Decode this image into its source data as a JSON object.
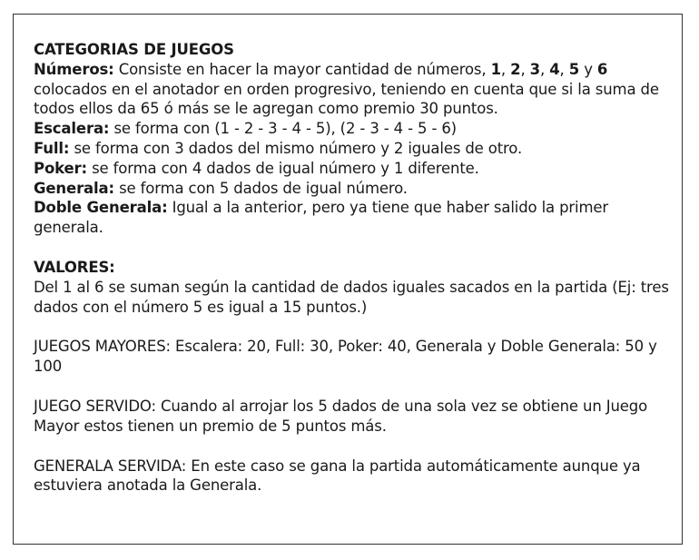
{
  "categorias": {
    "heading": "CATEGORIAS DE JUEGOS",
    "numeros": {
      "label": "Números:",
      "text1": " Consiste en hacer la mayor cantidad de números, ",
      "n1": "1",
      "sep1": ", ",
      "n2": "2",
      "sep2": ", ",
      "n3": "3",
      "sep3": ", ",
      "n4": "4",
      "sep4": ", ",
      "n5": "5",
      "sep5": " y ",
      "n6": "6",
      "text2": " colocados en el anotador en orden progresivo, teniendo en cuenta que si la suma de todos ellos da 65 ó más se le agregan como premio 30 puntos."
    },
    "escalera": {
      "label": "Escalera:",
      "text": " se forma con (1 - 2 - 3 - 4 - 5),  (2 - 3 - 4 - 5 - 6)"
    },
    "full": {
      "label": "Full:",
      "text": " se forma con 3 dados del mismo número y 2 iguales de otro."
    },
    "poker": {
      "label": "Poker:",
      "text": " se forma con 4 dados de igual número y 1 diferente."
    },
    "generala": {
      "label": "Generala:",
      "text": " se forma con 5 dados de igual número."
    },
    "doble": {
      "label": "Doble Generala:",
      "text": " Igual a la anterior, pero ya tiene que haber salido la primer generala."
    }
  },
  "valores": {
    "heading": "VALORES:",
    "text": "Del 1 al 6 se suman según la cantidad de dados iguales sacados en la partida (Ej: tres dados con el número 5 es igual a 15 puntos.)"
  },
  "juegos_mayores": "JUEGOS MAYORES: Escalera: 20, Full: 30, Poker: 40, Generala y Doble Generala: 50 y 100",
  "juego_servido": "JUEGO SERVIDO: Cuando al arrojar los 5 dados de una sola vez se obtiene un Juego Mayor estos tienen un premio de 5 puntos más.",
  "generala_servida": "GENERALA SERVIDA: En este caso se gana la partida automáticamente aunque ya estuviera anotada la Generala."
}
